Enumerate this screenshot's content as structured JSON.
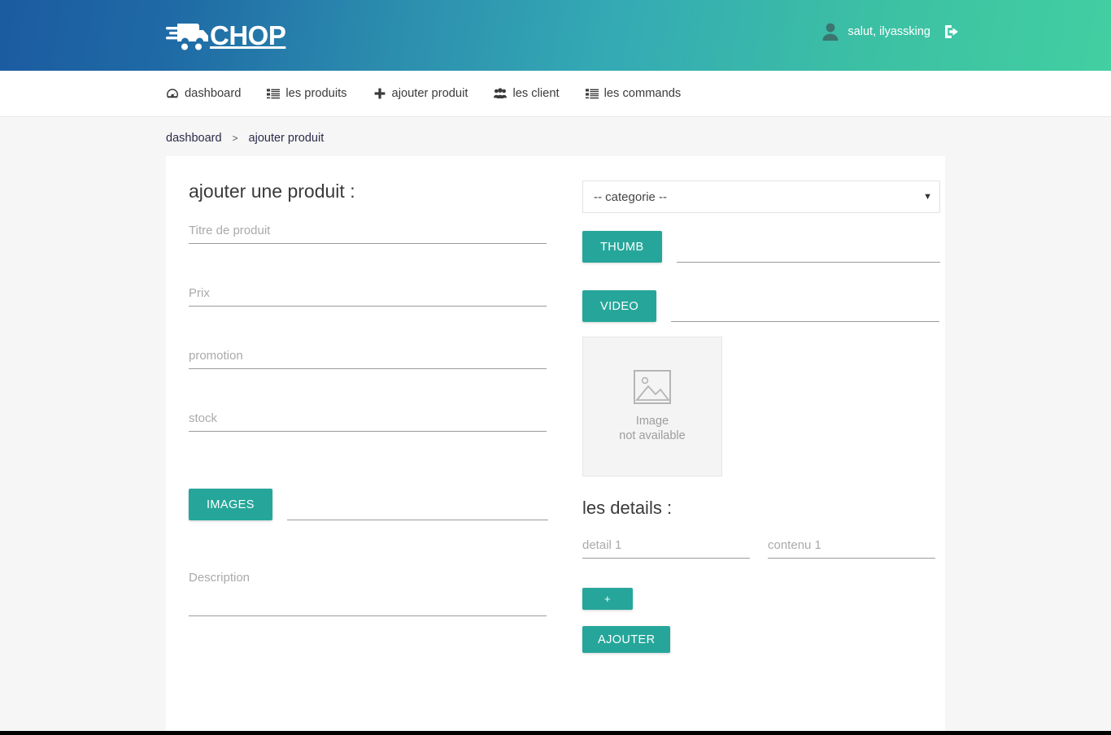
{
  "header": {
    "brand": "CHOP",
    "logo_icon": "delivery-cart-icon",
    "user_greeting": "salut, ilyassking",
    "avatar_icon": "user-avatar-icon",
    "logout_icon": "sign-out-icon"
  },
  "nav": {
    "items": [
      {
        "label": "dashboard",
        "icon": "tachometer-icon"
      },
      {
        "label": "les produits",
        "icon": "list-icon"
      },
      {
        "label": "ajouter produit",
        "icon": "plus-icon"
      },
      {
        "label": "les client",
        "icon": "users-icon"
      },
      {
        "label": "les commands",
        "icon": "list-icon"
      }
    ]
  },
  "breadcrumb": {
    "root": "dashboard",
    "separator": ">",
    "current": "ajouter produit"
  },
  "form": {
    "title": "ajouter une produit :",
    "fields": {
      "titre_placeholder": "Titre de produit",
      "titre_value": "",
      "prix_placeholder": "Prix",
      "prix_value": "",
      "promotion_placeholder": "promotion",
      "promotion_value": "",
      "stock_placeholder": "stock",
      "stock_value": "",
      "description_placeholder": "Description",
      "description_value": ""
    },
    "images_button": "IMAGES",
    "categorie_selected": "-- categorie --",
    "categorie_caret": "▼",
    "thumb_button": "THUMB",
    "video_button": "VIDEO",
    "image_placeholder": {
      "icon": "broken-image-icon",
      "line1": "Image",
      "line2": "not available"
    },
    "details_title": "les details :",
    "detail_placeholder": "detail 1",
    "detail_value": "",
    "contenu_placeholder": "contenu 1",
    "contenu_value": "",
    "add_detail_button": "+",
    "submit_button": "AJOUTER"
  },
  "colors": {
    "header_gradient_start": "#1b5ba0",
    "header_gradient_end": "#42cfa1",
    "accent_teal": "#26a69a",
    "page_background": "#f6f6f6",
    "card_background": "#ffffff"
  }
}
